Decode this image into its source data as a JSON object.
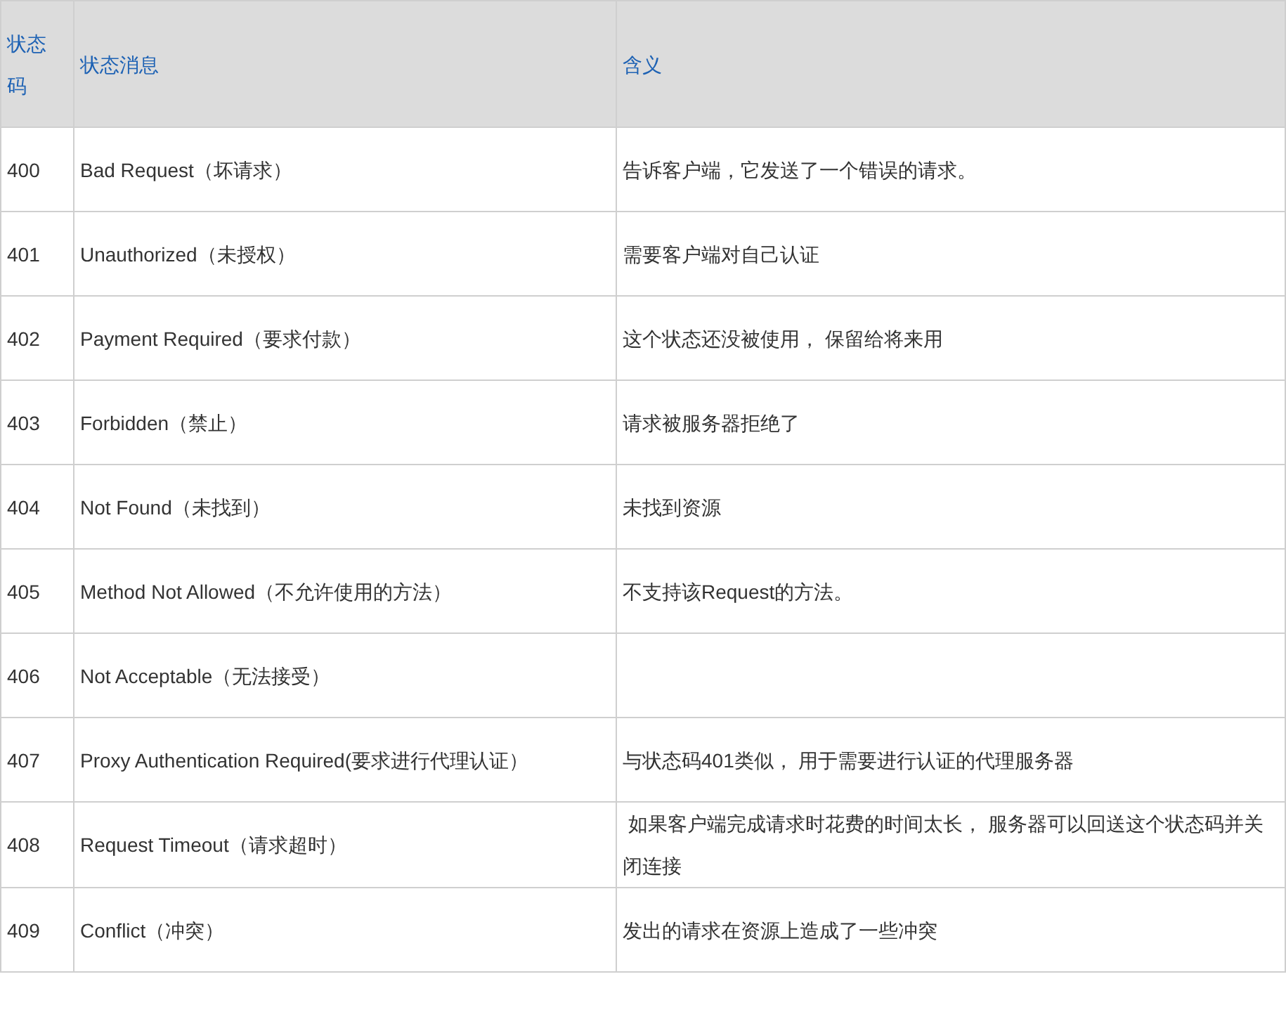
{
  "table": {
    "columns": [
      "状态码",
      "状态消息",
      "含义"
    ],
    "rows": [
      {
        "code": "400",
        "message": "Bad Request（坏请求）",
        "meaning": "告诉客户端，它发送了一个错误的请求。"
      },
      {
        "code": "401",
        "message": "Unauthorized（未授权）",
        "meaning": "需要客户端对自己认证"
      },
      {
        "code": "402",
        "message": "Payment Required（要求付款）",
        "meaning": "这个状态还没被使用， 保留给将来用"
      },
      {
        "code": "403",
        "message": "Forbidden（禁止）",
        "meaning": "请求被服务器拒绝了"
      },
      {
        "code": "404",
        "message": "Not Found（未找到）",
        "meaning": "未找到资源"
      },
      {
        "code": "405",
        "message": "Method Not Allowed（不允许使用的方法）",
        "meaning": "不支持该Request的方法。"
      },
      {
        "code": "406",
        "message": "Not Acceptable（无法接受）"
      },
      {
        "code": "407",
        "message": "Proxy Authentication Required(要求进行代理认证）",
        "meaning": "与状态码401类似， 用于需要进行认证的代理服务器"
      },
      {
        "code": "408",
        "message": "Request Timeout（请求超时）",
        "meaning": " 如果客户端完成请求时花费的时间太长， 服务器可以回送这个状态码并关闭连接"
      },
      {
        "code": "409",
        "message": "Conflict（冲突）",
        "meaning": "发出的请求在资源上造成了一些冲突"
      }
    ]
  }
}
